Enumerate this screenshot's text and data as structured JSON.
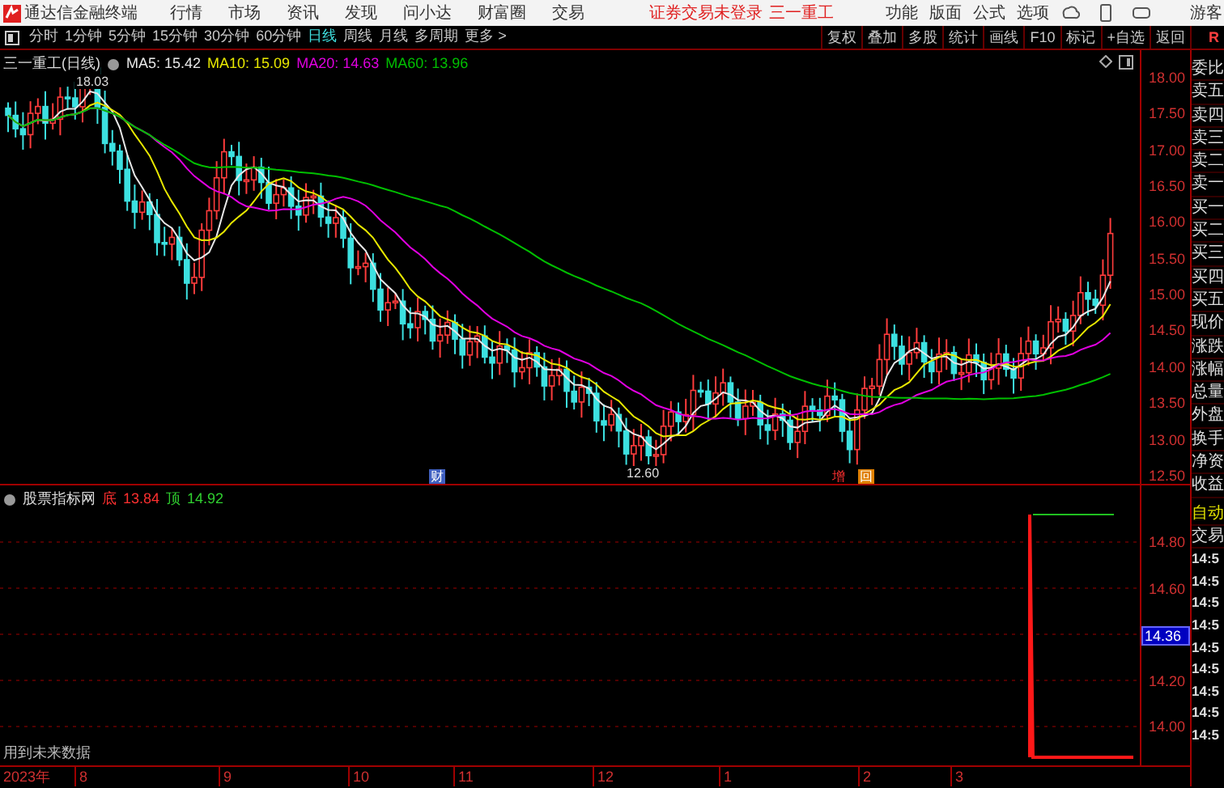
{
  "app": {
    "title": "通达信金融终端"
  },
  "menu": [
    "行情",
    "市场",
    "资讯",
    "发现",
    "问小达",
    "财富圈",
    "交易"
  ],
  "login_status": "证券交易未登录",
  "stock_name": "三一重工",
  "right_menu": [
    "功能",
    "版面",
    "公式",
    "选项"
  ],
  "user": "游客",
  "periods": [
    {
      "label": "分时",
      "selected": false
    },
    {
      "label": "1分钟",
      "selected": false
    },
    {
      "label": "5分钟",
      "selected": false
    },
    {
      "label": "15分钟",
      "selected": false
    },
    {
      "label": "30分钟",
      "selected": false
    },
    {
      "label": "60分钟",
      "selected": false
    },
    {
      "label": "日线",
      "selected": true
    },
    {
      "label": "周线",
      "selected": false
    },
    {
      "label": "月线",
      "selected": false
    },
    {
      "label": "多周期",
      "selected": false
    },
    {
      "label": "更多 >",
      "selected": false
    }
  ],
  "tools": [
    "复权",
    "叠加",
    "多股",
    "统计",
    "画线",
    "F10",
    "标记",
    "+自选",
    "返回"
  ],
  "side_tab": "R",
  "chart": {
    "title": "三一重工(日线)",
    "ma": [
      {
        "label": "MA5: 15.42",
        "color": "#e8e8e8"
      },
      {
        "label": "MA10: 15.09",
        "color": "#e8e800"
      },
      {
        "label": "MA20: 14.63",
        "color": "#e000e0"
      },
      {
        "label": "MA60: 13.96",
        "color": "#00c000"
      }
    ],
    "high_label": "18.03",
    "low_label": "12.60",
    "price_ticks": [
      "18.00",
      "17.50",
      "17.00",
      "16.50",
      "16.00",
      "15.50",
      "15.00",
      "14.50",
      "14.00",
      "13.50",
      "13.00",
      "12.50"
    ],
    "markers": [
      {
        "text": "财",
        "color": "#4060c0"
      },
      {
        "text": "增",
        "color": "#ff3030"
      },
      {
        "text": "回",
        "color": "#e08000"
      }
    ]
  },
  "indicator": {
    "name": "股票指标网",
    "bottom_label": "底",
    "bottom_value": "13.84",
    "top_label": "顶",
    "top_value": "14.92",
    "ticks": [
      {
        "label": "14.80",
        "current": false
      },
      {
        "label": "14.60",
        "current": false
      },
      {
        "label": "14.36",
        "current": true
      },
      {
        "label": "14.20",
        "current": false
      },
      {
        "label": "14.00",
        "current": false
      }
    ],
    "note": "用到未来数据"
  },
  "x_axis": [
    "2023年",
    "8",
    "9",
    "10",
    "11",
    "12",
    "1",
    "2",
    "3"
  ],
  "quote_panel": {
    "labels": [
      "委比",
      "卖五",
      "卖四",
      "卖三",
      "卖二",
      "卖一",
      "买一",
      "买二",
      "买三",
      "买四",
      "买五",
      "现价",
      "涨跌",
      "涨幅",
      "总量",
      "外盘",
      "换手",
      "净资",
      "收益"
    ],
    "auto": "自动",
    "trade": "交易",
    "times": [
      "14:5",
      "14:5",
      "14:5",
      "14:5",
      "14:5",
      "14:5",
      "14:5",
      "14:5",
      "14:5"
    ]
  }
}
